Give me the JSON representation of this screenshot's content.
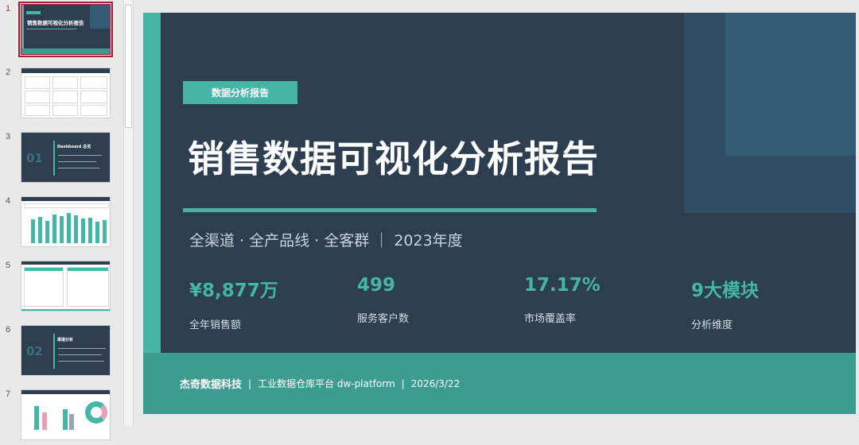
{
  "thumbnails": [
    {
      "num": "1",
      "caption": "销售数据可视化分析报告"
    },
    {
      "num": "2"
    },
    {
      "num": "3",
      "badge": "01",
      "caption": "Dashboard 总览"
    },
    {
      "num": "4"
    },
    {
      "num": "5"
    },
    {
      "num": "6",
      "badge": "02",
      "caption": "渠道分析"
    },
    {
      "num": "7"
    }
  ],
  "slide": {
    "tag": "数据分析报告",
    "title": "销售数据可视化分析报告",
    "subtitle": "全渠道 · 全产品线 · 全客群 ｜ 2023年度",
    "kpis": [
      {
        "value": "¥8,877万",
        "label": "全年销售额"
      },
      {
        "value": "499",
        "label": "服务客户数"
      },
      {
        "value": "17.17%",
        "label": "市场覆盖率"
      },
      {
        "value": "9大模块",
        "label": "分析维度"
      }
    ],
    "footer": {
      "company": "杰奇数据科技",
      "sep": "|",
      "platform": "工业数据仓库平台 dw-platform",
      "date": "2026/3/22"
    }
  },
  "colors": {
    "accent": "#45b5a5",
    "slide_bg": "#2c3e50",
    "footer_bg": "#3c9c90",
    "selected": "#9b2230"
  }
}
